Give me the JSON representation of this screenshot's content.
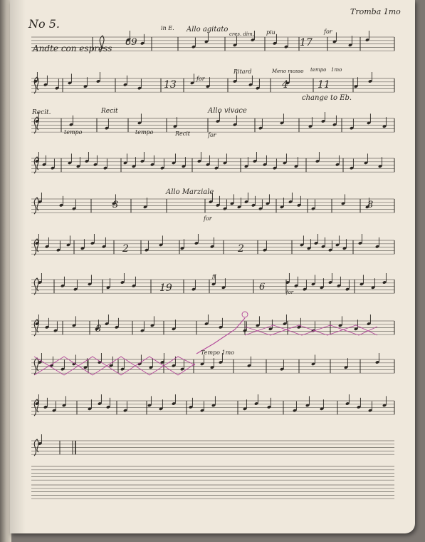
{
  "page": {
    "number_label": "No 5.",
    "part_label": "Tromba 1mo"
  },
  "colors": {
    "paper": "#efe8dc",
    "ink": "#2b2722",
    "staff_line": "#6f6a63",
    "correction_ink": "#b2479a"
  },
  "systems": [
    {
      "texts": [
        "Andte con espress",
        "69",
        "in E.",
        "Allo agitato",
        "cres. dim.",
        "piu",
        "17",
        "for"
      ]
    },
    {
      "texts": [
        "13",
        "for",
        "Ritard",
        "Meno mosso",
        "tempo",
        "1mo",
        "4",
        "11",
        "change to Eb."
      ]
    },
    {
      "texts": [
        "Recit.",
        "tempo",
        "Recit",
        "tempo",
        "Recit",
        "Allo vivace",
        "for"
      ]
    },
    {
      "texts": []
    },
    {
      "texts": [
        "3",
        "Allo Marziale",
        "for",
        "8"
      ]
    },
    {
      "texts": [
        "2",
        "2"
      ]
    },
    {
      "texts": [
        "19",
        "ff",
        "6",
        "for"
      ]
    },
    {
      "texts": [
        "8"
      ]
    },
    {
      "texts": [
        "Tempo 1mo"
      ]
    },
    {
      "texts": []
    },
    {
      "texts": []
    }
  ]
}
